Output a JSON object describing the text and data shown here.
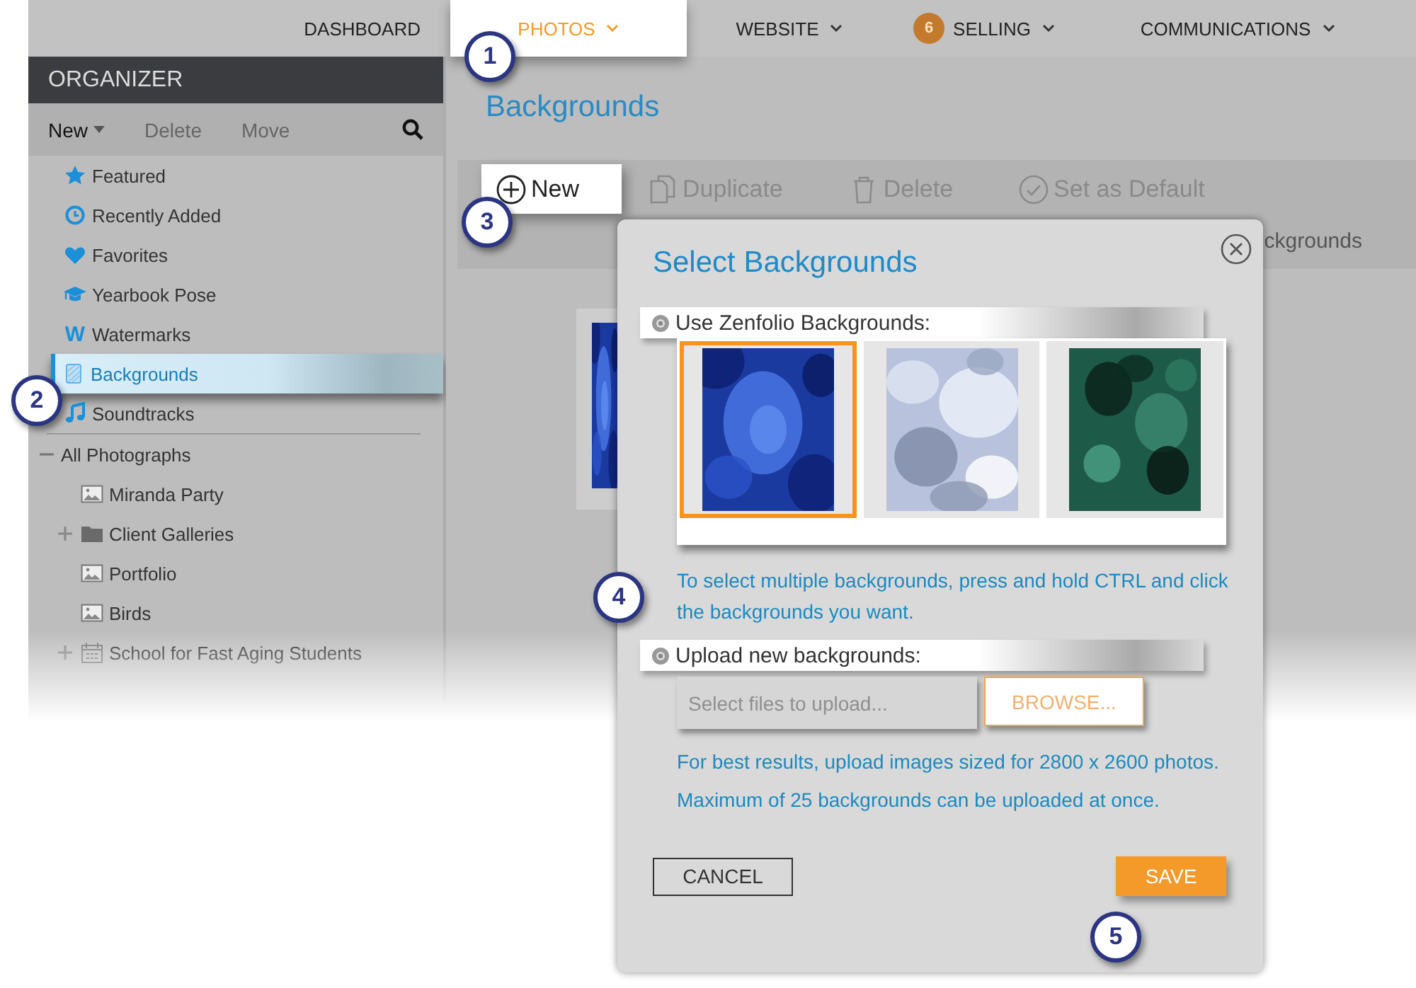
{
  "nav": {
    "items": [
      {
        "label": "DASHBOARD",
        "selected": false,
        "dropdown": false
      },
      {
        "label": "PHOTOS",
        "selected": true,
        "dropdown": true
      },
      {
        "label": "WEBSITE",
        "selected": false,
        "dropdown": true
      },
      {
        "label": "SELLING",
        "selected": false,
        "dropdown": true,
        "badge": "6"
      },
      {
        "label": "COMMUNICATIONS",
        "selected": false,
        "dropdown": true
      }
    ]
  },
  "organizer": {
    "title": "ORGANIZER",
    "toolbar": [
      {
        "label": "New",
        "disabled": false,
        "dropdown": true
      },
      {
        "label": "Delete",
        "disabled": true,
        "dropdown": false
      },
      {
        "label": "Move",
        "disabled": true,
        "dropdown": false
      }
    ],
    "shortcuts": [
      {
        "kind": "featured",
        "label": "Featured",
        "selected": false
      },
      {
        "kind": "recent",
        "label": "Recently Added",
        "selected": false
      },
      {
        "kind": "favorites",
        "label": "Favorites",
        "selected": false
      },
      {
        "kind": "pose",
        "label": "Yearbook Pose",
        "selected": false
      },
      {
        "kind": "watermarks",
        "glyph": "W",
        "label": "Watermarks",
        "selected": false
      },
      {
        "kind": "backgrounds",
        "label": "Backgrounds",
        "selected": true
      },
      {
        "kind": "soundtracks",
        "label": "Soundtracks",
        "selected": false
      }
    ],
    "tree": [
      {
        "label": "All Photographs",
        "expanded": true,
        "selected": false,
        "children": [
          {
            "label": "Miranda Party",
            "kind": "gallery",
            "selected": false
          },
          {
            "label": "Client Galleries",
            "kind": "folder",
            "expanded": false,
            "selected": false
          },
          {
            "label": "Portfolio",
            "kind": "gallery",
            "selected": false
          },
          {
            "label": "Birds",
            "kind": "gallery",
            "selected": false
          },
          {
            "label": "School for Fast Aging Students",
            "kind": "event",
            "expanded": false,
            "selected": false
          }
        ]
      }
    ]
  },
  "main": {
    "title": "Backgrounds",
    "toolbar": [
      {
        "kind": "new",
        "label": "New",
        "disabled": false,
        "highlighted": true
      },
      {
        "kind": "duplicate",
        "label": "Duplicate",
        "disabled": true,
        "highlighted": false
      },
      {
        "kind": "delete",
        "label": "Delete",
        "disabled": true,
        "highlighted": false
      },
      {
        "kind": "default",
        "label": "Set as Default",
        "disabled": true,
        "highlighted": false
      }
    ],
    "partial_label": "ckgrounds"
  },
  "dialog": {
    "title": "Select Backgrounds",
    "library": {
      "label": "Use Zenfolio Backgrounds:",
      "highlighted": true,
      "backgrounds": [
        {
          "selected": true
        },
        {
          "selected": false
        },
        {
          "selected": false
        }
      ],
      "hint": "To select multiple backgrounds, press and hold CTRL and click the backgrounds you want."
    },
    "upload": {
      "label": "Upload new backgrounds:",
      "highlighted": true,
      "placeholder": "Select files to upload...",
      "browse": "BROWSE...",
      "notes": [
        "For best results, upload images sized for 2800 x 2600 photos.",
        "Maximum of 25 backgrounds can be uploaded at once."
      ]
    },
    "buttons": [
      {
        "kind": "cancel",
        "label": "CANCEL"
      },
      {
        "kind": "save",
        "label": "SAVE"
      }
    ]
  },
  "callouts": [
    "1",
    "2",
    "3",
    "4",
    "5"
  ]
}
